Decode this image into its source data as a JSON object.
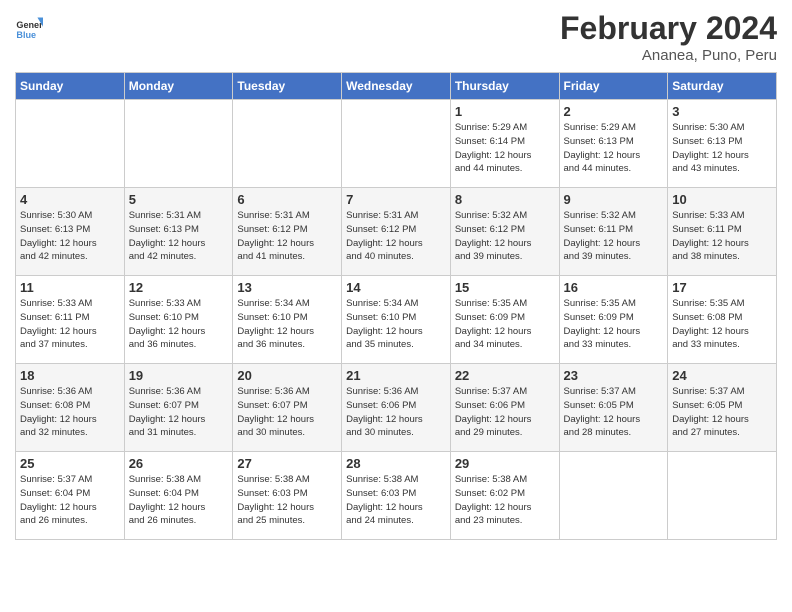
{
  "logo": {
    "line1": "General",
    "line2": "Blue"
  },
  "title": "February 2024",
  "subtitle": "Ananea, Puno, Peru",
  "days_of_week": [
    "Sunday",
    "Monday",
    "Tuesday",
    "Wednesday",
    "Thursday",
    "Friday",
    "Saturday"
  ],
  "weeks": [
    [
      {
        "day": "",
        "info": ""
      },
      {
        "day": "",
        "info": ""
      },
      {
        "day": "",
        "info": ""
      },
      {
        "day": "",
        "info": ""
      },
      {
        "day": "1",
        "info": "Sunrise: 5:29 AM\nSunset: 6:14 PM\nDaylight: 12 hours\nand 44 minutes."
      },
      {
        "day": "2",
        "info": "Sunrise: 5:29 AM\nSunset: 6:13 PM\nDaylight: 12 hours\nand 44 minutes."
      },
      {
        "day": "3",
        "info": "Sunrise: 5:30 AM\nSunset: 6:13 PM\nDaylight: 12 hours\nand 43 minutes."
      }
    ],
    [
      {
        "day": "4",
        "info": "Sunrise: 5:30 AM\nSunset: 6:13 PM\nDaylight: 12 hours\nand 42 minutes."
      },
      {
        "day": "5",
        "info": "Sunrise: 5:31 AM\nSunset: 6:13 PM\nDaylight: 12 hours\nand 42 minutes."
      },
      {
        "day": "6",
        "info": "Sunrise: 5:31 AM\nSunset: 6:12 PM\nDaylight: 12 hours\nand 41 minutes."
      },
      {
        "day": "7",
        "info": "Sunrise: 5:31 AM\nSunset: 6:12 PM\nDaylight: 12 hours\nand 40 minutes."
      },
      {
        "day": "8",
        "info": "Sunrise: 5:32 AM\nSunset: 6:12 PM\nDaylight: 12 hours\nand 39 minutes."
      },
      {
        "day": "9",
        "info": "Sunrise: 5:32 AM\nSunset: 6:11 PM\nDaylight: 12 hours\nand 39 minutes."
      },
      {
        "day": "10",
        "info": "Sunrise: 5:33 AM\nSunset: 6:11 PM\nDaylight: 12 hours\nand 38 minutes."
      }
    ],
    [
      {
        "day": "11",
        "info": "Sunrise: 5:33 AM\nSunset: 6:11 PM\nDaylight: 12 hours\nand 37 minutes."
      },
      {
        "day": "12",
        "info": "Sunrise: 5:33 AM\nSunset: 6:10 PM\nDaylight: 12 hours\nand 36 minutes."
      },
      {
        "day": "13",
        "info": "Sunrise: 5:34 AM\nSunset: 6:10 PM\nDaylight: 12 hours\nand 36 minutes."
      },
      {
        "day": "14",
        "info": "Sunrise: 5:34 AM\nSunset: 6:10 PM\nDaylight: 12 hours\nand 35 minutes."
      },
      {
        "day": "15",
        "info": "Sunrise: 5:35 AM\nSunset: 6:09 PM\nDaylight: 12 hours\nand 34 minutes."
      },
      {
        "day": "16",
        "info": "Sunrise: 5:35 AM\nSunset: 6:09 PM\nDaylight: 12 hours\nand 33 minutes."
      },
      {
        "day": "17",
        "info": "Sunrise: 5:35 AM\nSunset: 6:08 PM\nDaylight: 12 hours\nand 33 minutes."
      }
    ],
    [
      {
        "day": "18",
        "info": "Sunrise: 5:36 AM\nSunset: 6:08 PM\nDaylight: 12 hours\nand 32 minutes."
      },
      {
        "day": "19",
        "info": "Sunrise: 5:36 AM\nSunset: 6:07 PM\nDaylight: 12 hours\nand 31 minutes."
      },
      {
        "day": "20",
        "info": "Sunrise: 5:36 AM\nSunset: 6:07 PM\nDaylight: 12 hours\nand 30 minutes."
      },
      {
        "day": "21",
        "info": "Sunrise: 5:36 AM\nSunset: 6:06 PM\nDaylight: 12 hours\nand 30 minutes."
      },
      {
        "day": "22",
        "info": "Sunrise: 5:37 AM\nSunset: 6:06 PM\nDaylight: 12 hours\nand 29 minutes."
      },
      {
        "day": "23",
        "info": "Sunrise: 5:37 AM\nSunset: 6:05 PM\nDaylight: 12 hours\nand 28 minutes."
      },
      {
        "day": "24",
        "info": "Sunrise: 5:37 AM\nSunset: 6:05 PM\nDaylight: 12 hours\nand 27 minutes."
      }
    ],
    [
      {
        "day": "25",
        "info": "Sunrise: 5:37 AM\nSunset: 6:04 PM\nDaylight: 12 hours\nand 26 minutes."
      },
      {
        "day": "26",
        "info": "Sunrise: 5:38 AM\nSunset: 6:04 PM\nDaylight: 12 hours\nand 26 minutes."
      },
      {
        "day": "27",
        "info": "Sunrise: 5:38 AM\nSunset: 6:03 PM\nDaylight: 12 hours\nand 25 minutes."
      },
      {
        "day": "28",
        "info": "Sunrise: 5:38 AM\nSunset: 6:03 PM\nDaylight: 12 hours\nand 24 minutes."
      },
      {
        "day": "29",
        "info": "Sunrise: 5:38 AM\nSunset: 6:02 PM\nDaylight: 12 hours\nand 23 minutes."
      },
      {
        "day": "",
        "info": ""
      },
      {
        "day": "",
        "info": ""
      }
    ]
  ]
}
